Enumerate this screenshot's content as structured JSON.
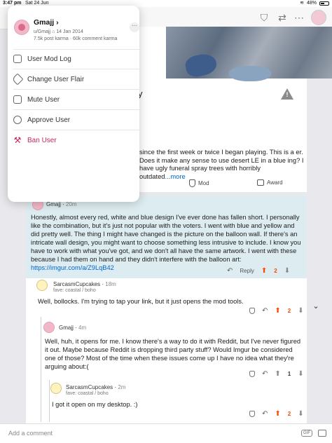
{
  "status_bar": {
    "time": "3:47 pm",
    "date": "Sat 24 Jun",
    "battery": "48%"
  },
  "post": {
    "title_fragment": "y",
    "body": "since the first week or twice I began playing.  This is a er.  Does it make any sense to use desert LE in a blue ing? I have ugly funeral spray trees with horribly outdated",
    "more_label": "...more",
    "actions": {
      "mod": "Mod",
      "award": "Award"
    }
  },
  "user_popover": {
    "username": "Gmajj",
    "handle": "u/Gmajj",
    "cake_date": "14 Jan 2014",
    "karma": "7.5k post karma · 60k comment karma",
    "more_label": "···",
    "menu": [
      {
        "label": "User Mod Log",
        "icon": "shield-icon"
      },
      {
        "label": "Change User Flair",
        "icon": "tag-icon"
      },
      {
        "label": "Mute User",
        "icon": "mute-icon"
      },
      {
        "label": "Approve User",
        "icon": "approve-icon"
      },
      {
        "label": "Ban User",
        "icon": "hammer-icon"
      }
    ]
  },
  "comments": [
    {
      "author": "Gmajj",
      "time": "20m",
      "body": "Honestly, almost every red, white and blue design I've ever done has fallen short. I personally like the combination, but it's just not popular with the voters. I went with blue and yellow and did pretty well. The thing I might have changed is the picture on the balloon wall. If there's an intricate wall design, you might want to choose something less intrusive to include. I know you have to work with what you've got, and we don't all have the same artwork. I went with these because I had them on hand and they didn't interfere with the balloon art:",
      "link": "https://imgur.com/a/Z9LqB42",
      "reply_label": "Reply",
      "score": "2"
    },
    {
      "author": "SarcasmCupcakes",
      "time": "18m",
      "flair": "fave: coastal / boho",
      "body": "Well, bollocks. I'm trying to tap your link, but it just opens the mod tools.",
      "score": "2"
    },
    {
      "author": "Gmajj",
      "time": "4m",
      "body": "Well, huh, it opens for me. I know there's a way to do it with Reddit, but I've never figured it out. Maybe because Reddit is dropping third party stuff?  Would Imgur be considered one of those?  Most of the time when these issues come up I have no idea what they're arguing about:(",
      "score": "1"
    },
    {
      "author": "SarcasmCupcakes",
      "time": "2m",
      "flair": "fave: coastal / boho",
      "body": "I got it open on my desktop. :)",
      "score": "2"
    }
  ],
  "composer": {
    "placeholder": "Add a comment",
    "gif_label": "GIF"
  }
}
